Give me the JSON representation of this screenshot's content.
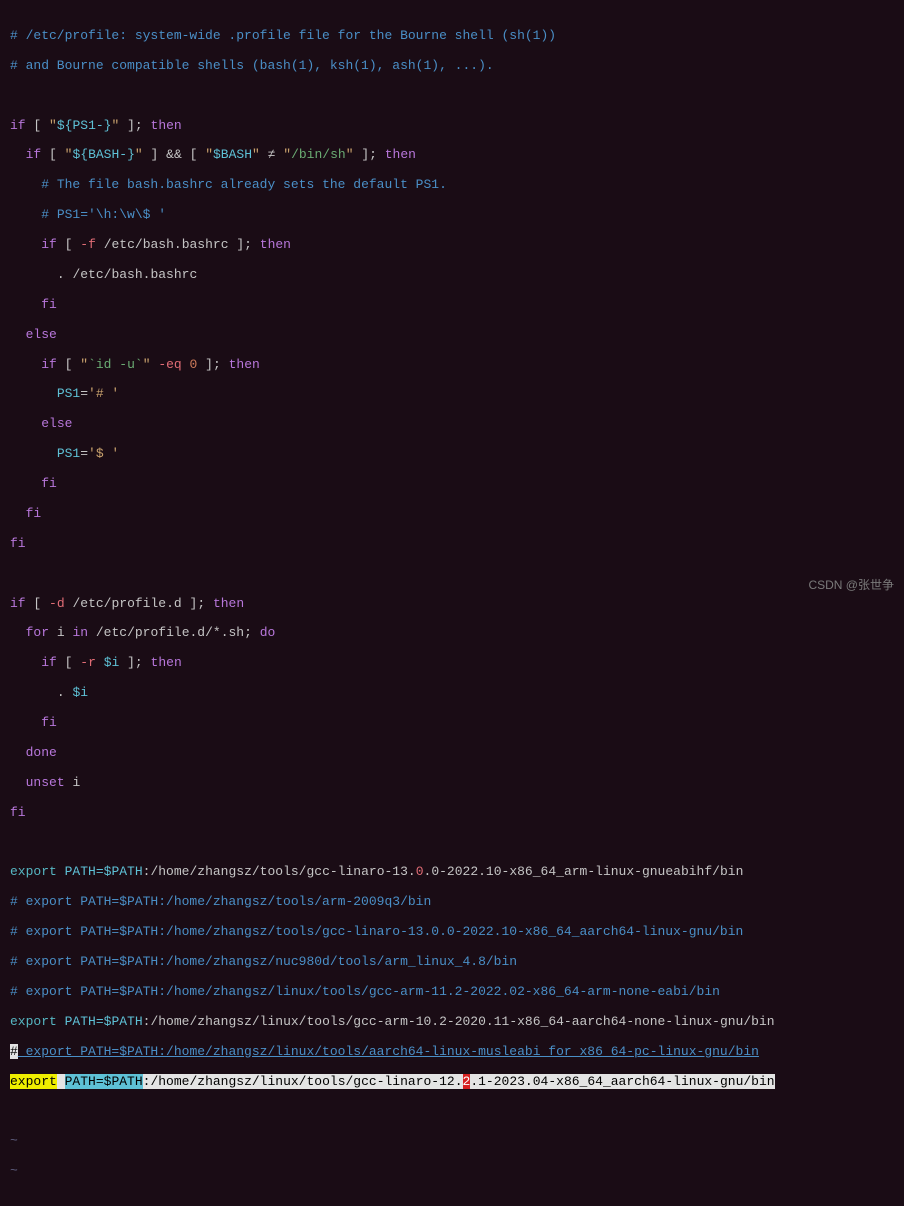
{
  "lines": {
    "l1": "# /etc/profile: system-wide .profile file for the Bourne shell (sh(1))",
    "l2": "# and Bourne compatible shells (bash(1), ksh(1), ash(1), ...).",
    "if1": "if",
    "bracket_open": "[",
    "bracket_close": "]",
    "ps1_var": "${PS1-}",
    "quote": "\"",
    "semicolon": ";",
    "then": "then",
    "bash_var": "${BASH-}",
    "and": "&&",
    "bash_str": "$BASH",
    "neq": "≠",
    "binsh": "/bin/sh",
    "comment_bashrc": "# The file bash.bashrc already sets the default PS1.",
    "comment_ps1": "# PS1='\\h:\\w\\$ '",
    "flag_f": "-f",
    "etc_bashrc": "/etc/bash.bashrc",
    "dot": ".",
    "fi": "fi",
    "else": "else",
    "idu": "`id -u`",
    "eq_flag": "-eq",
    "zero": "0",
    "ps1_hash": "PS1='# '",
    "ps1_dollar": "PS1='$ '",
    "flag_d": "-d",
    "profile_d": "/etc/profile.d",
    "for": "for",
    "i_var": "i",
    "in": "in",
    "profile_glob": "/etc/profile.d/*.sh",
    "do": "do",
    "flag_r": "-r",
    "dollar_i": "$i",
    "done": "done",
    "unset": "unset",
    "export": "export",
    "path_eq": "PATH=",
    "path_var": "$PATH",
    "path1_a": ":/home/zhangsz/tools/gcc-linaro-13.",
    "path1_zero": "0",
    "path1_b": ".0-2022.10-x86_64_arm-linux-gnueabihf/bin",
    "c_path2": "# export PATH=$PATH:/home/zhangsz/tools/arm-2009q3/bin",
    "c_path3": "# export PATH=$PATH:/home/zhangsz/tools/gcc-linaro-13.0.0-2022.10-x86_64_aarch64-linux-gnu/bin",
    "c_path4": "# export PATH=$PATH:/home/zhangsz/nuc980d/tools/arm_linux_4.8/bin",
    "c_path5": "# export PATH=$PATH:/home/zhangsz/linux/tools/gcc-arm-11.2-2022.02-x86_64-arm-none-eabi/bin",
    "path6": ":/home/zhangsz/linux/tools/gcc-arm-10.2-2020.11-x86_64-aarch64-none-linux-gnu/bin",
    "hash": "#",
    "c_path7": " export PATH=$PATH:/home/zhangsz/linux/tools/aarch64-linux-musleabi_for_x86_64-pc-linux-gnu/bin",
    "path8_a": ":/home/zhangsz/linux/tools/gcc-linaro-12.",
    "path8_two": "2",
    "path8_b": ".1-2023.04-x86_64_aarch64-linux-gnu/bin",
    "tilde": "~",
    "watermark": "CSDN @张世争"
  }
}
